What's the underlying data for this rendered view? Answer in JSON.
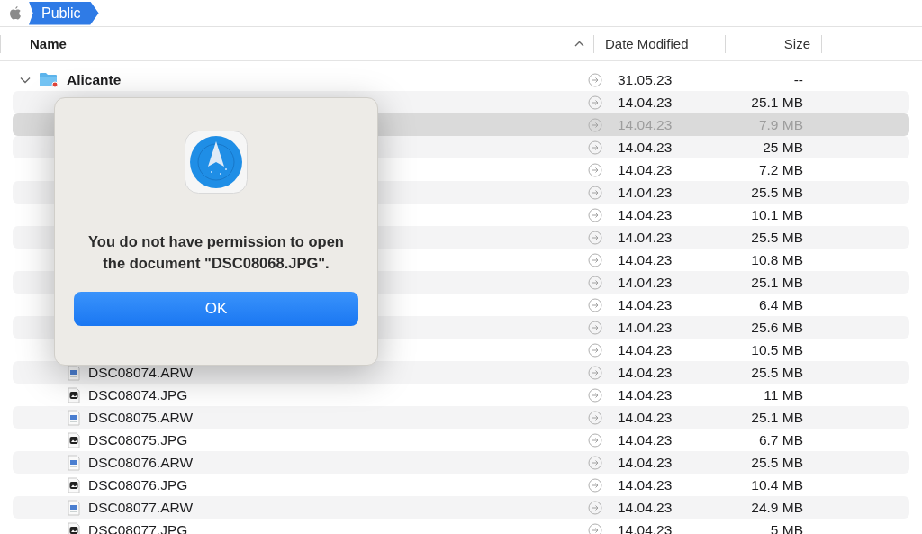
{
  "path_bar": {
    "crumbs": [
      {
        "label": "Public",
        "selected": true
      }
    ]
  },
  "columns": [
    {
      "label": "Name",
      "sorted": true
    },
    {
      "label": "Date Modified",
      "sorted": false
    },
    {
      "label": "Size",
      "sorted": false
    }
  ],
  "folder": {
    "name": "Alicante",
    "expanded": true,
    "date": "31.05.23",
    "size": "--",
    "children": [
      {
        "date": "14.04.23",
        "size": "25.1 MB",
        "selected": false
      },
      {
        "date": "14.04.23",
        "size": "7.9 MB",
        "selected": true
      },
      {
        "date": "14.04.23",
        "size": "25 MB",
        "selected": false
      },
      {
        "date": "14.04.23",
        "size": "7.2 MB",
        "selected": false
      },
      {
        "date": "14.04.23",
        "size": "25.5 MB",
        "selected": false
      },
      {
        "date": "14.04.23",
        "size": "10.1 MB",
        "selected": false
      },
      {
        "date": "14.04.23",
        "size": "25.5 MB",
        "selected": false
      },
      {
        "date": "14.04.23",
        "size": "10.8 MB",
        "selected": false
      },
      {
        "date": "14.04.23",
        "size": "25.1 MB",
        "selected": false
      },
      {
        "date": "14.04.23",
        "size": "6.4 MB",
        "selected": false
      },
      {
        "date": "14.04.23",
        "size": "25.6 MB",
        "selected": false
      },
      {
        "date": "14.04.23",
        "size": "10.5 MB",
        "selected": false
      },
      {
        "name": "DSC08074.ARW",
        "kind": "raw",
        "date": "14.04.23",
        "size": "25.5 MB",
        "selected": false
      },
      {
        "name": "DSC08074.JPG",
        "kind": "jpeg",
        "date": "14.04.23",
        "size": "11 MB",
        "selected": false
      },
      {
        "name": "DSC08075.ARW",
        "kind": "raw",
        "date": "14.04.23",
        "size": "25.1 MB",
        "selected": false
      },
      {
        "name": "DSC08075.JPG",
        "kind": "jpeg",
        "date": "14.04.23",
        "size": "6.7 MB",
        "selected": false
      },
      {
        "name": "DSC08076.ARW",
        "kind": "raw",
        "date": "14.04.23",
        "size": "25.5 MB",
        "selected": false
      },
      {
        "name": "DSC08076.JPG",
        "kind": "jpeg",
        "date": "14.04.23",
        "size": "10.4 MB",
        "selected": false
      },
      {
        "name": "DSC08077.ARW",
        "kind": "raw",
        "date": "14.04.23",
        "size": "24.9 MB",
        "selected": false
      },
      {
        "name": "DSC08077.JPG",
        "kind": "jpeg",
        "date": "14.04.23",
        "size": "5 MB",
        "selected": false
      }
    ]
  },
  "dialog": {
    "message": "You do not have permission to open the document \"DSC08068.JPG\".",
    "button": "OK"
  }
}
